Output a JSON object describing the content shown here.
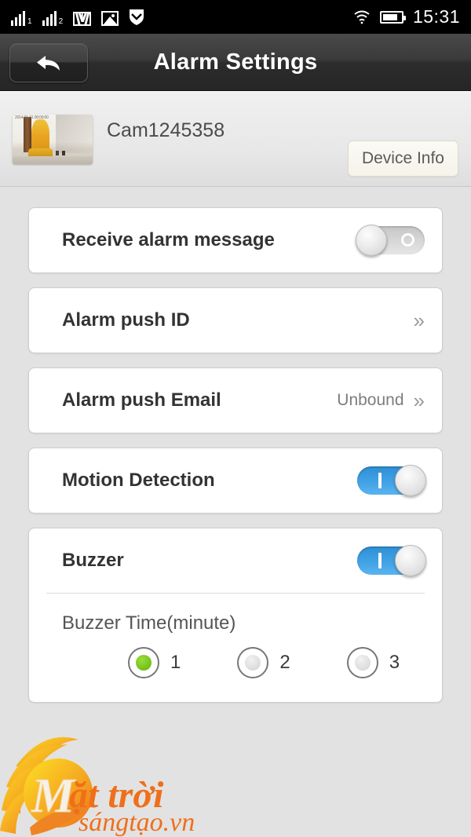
{
  "statusbar": {
    "signal1_label": "1",
    "signal2_label": "2",
    "icons": [
      "signal-bars-1-icon",
      "signal-bars-2-icon",
      "gmail-icon",
      "photo-icon",
      "shield-download-icon",
      "wifi-icon",
      "battery-icon"
    ],
    "time": "15:31"
  },
  "header": {
    "title": "Alarm Settings",
    "back_icon": "back-arrow-icon"
  },
  "device": {
    "name": "Cam1245358",
    "info_button": "Device Info",
    "thumbnail_stamp": "2014-01-01 00:00:00"
  },
  "settings": {
    "receive_alarm": {
      "label": "Receive alarm message",
      "state": "off"
    },
    "alarm_push_id": {
      "label": "Alarm push ID",
      "value": "",
      "chevron": "»"
    },
    "alarm_push_email": {
      "label": "Alarm push Email",
      "value": "Unbound",
      "chevron": "»"
    },
    "motion_detection": {
      "label": "Motion Detection",
      "state": "on"
    },
    "buzzer": {
      "label": "Buzzer",
      "state": "on"
    },
    "buzzer_time": {
      "label": "Buzzer Time(minute)",
      "options": [
        "1",
        "2",
        "3"
      ],
      "selected": "1"
    }
  },
  "watermark": {
    "line1": "ặt trời",
    "line2": "sángtạo.vn"
  },
  "colors": {
    "accent_blue": "#3fa0e4",
    "radio_green": "#7fcc26",
    "background": "#e2e2e2",
    "card": "#ffffff",
    "watermark_orange": "#f07b1d"
  }
}
